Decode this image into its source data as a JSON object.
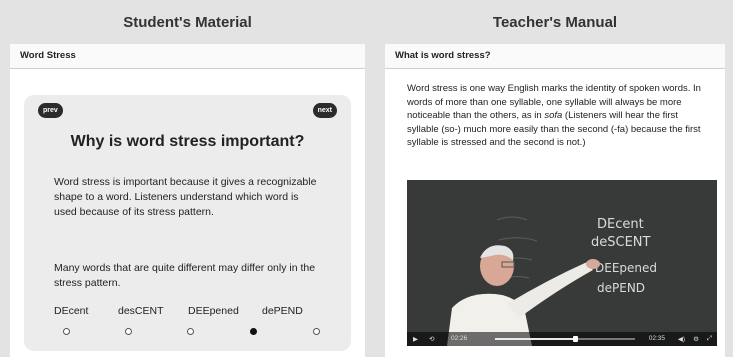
{
  "left_column": {
    "title": "Student's Material",
    "panel_header": "Word Stress",
    "prev_label": "prev",
    "next_label": "next",
    "card_title": "Why is word stress important?",
    "paragraph1": "Word stress is important because it gives a recognizable shape to a word. Listeners understand which word is used because of its stress pattern.",
    "paragraph2": "Many words that are quite different may differ only in the stress pattern.",
    "words": [
      "DEcent",
      "desCENT",
      "DEEpened",
      "dePEND"
    ],
    "pagination": {
      "total": 5,
      "active": 4
    }
  },
  "right_column": {
    "title": "Teacher's Manual",
    "panel_header": "What is word stress?",
    "text_before": "Word stress is one way English marks the identity of spoken words. In words of more than one syllable, one syllable will always be more noticeable than the others, as in ",
    "text_italic": "sofa",
    "text_after": " (Listeners will hear the first syllable (so-) much more easily than the second (-fa) because the first syllable is stressed and the second is not.)",
    "video": {
      "chalk_words": [
        "DEcent",
        "deSCENT",
        "DEEpened",
        "dePEND"
      ],
      "elapsed": "02:26",
      "duration": "02:35",
      "progress": 0.56
    }
  }
}
